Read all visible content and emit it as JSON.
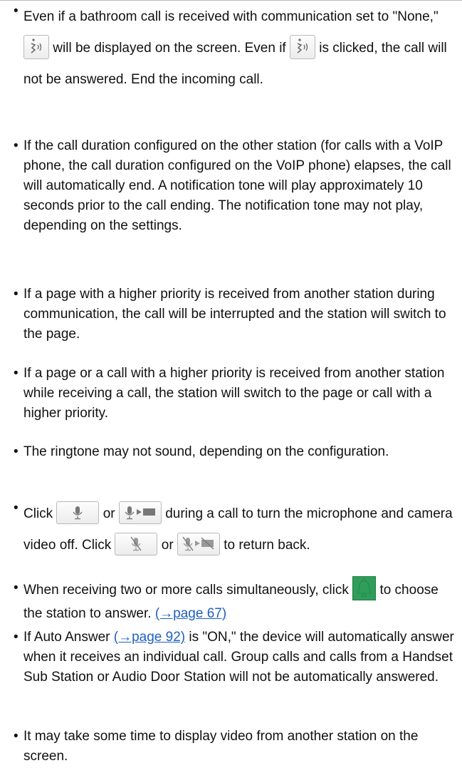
{
  "bullet": "•",
  "items": [
    {
      "a": "Even if a bathroom call is received with communication set to \"None,\"",
      "b": "will be displayed on the screen. Even if",
      "c": "is clicked, the call will not be answered. End the incoming call."
    },
    {
      "text": "If the call duration configured on the other station (for calls with a VoIP phone, the call duration configured on the VoIP phone) elapses, the call will automatically end. A notification tone will play approximately 10 seconds prior to the call ending. The notification tone may not play, depending on the settings."
    },
    {
      "text": "If a page with a higher priority is received from another station during communication, the call will be interrupted and the station will switch to the page."
    },
    {
      "text": "If a page or a call with a higher priority is received from another station while receiving a call, the station will switch to the page or call with a higher priority."
    },
    {
      "text": "The ringtone may not sound, depending on the configuration."
    },
    {
      "a": "Click",
      "b": "or",
      "c": "during a call to turn the microphone and camera video off. Click",
      "d": "or",
      "e": "to return back."
    },
    {
      "a": "When receiving two or more calls simultaneously, click",
      "b": "to choose the station to answer.",
      "link": "(→page 67)"
    },
    {
      "a": "If Auto Answer",
      "link": "(→page 92)",
      "b": "is \"ON,\" the device will automatically answer when it receives an individual call. Group calls and calls from a Handset Sub Station or Audio Door Station will not be automatically answered."
    },
    {
      "text": "It may take some time to display video from another station on the screen."
    }
  ],
  "icons": {
    "call_answer": "bathroom-call-answer-icon",
    "mic_on": "microphone-icon",
    "mic_video_on": "microphone-video-icon",
    "mic_off": "microphone-off-icon",
    "mic_video_off": "microphone-video-off-icon",
    "bell": "bell-icon"
  },
  "colors": {
    "link": "#1f5fbf",
    "bell": "#2f9e5a",
    "text": "#111111"
  }
}
